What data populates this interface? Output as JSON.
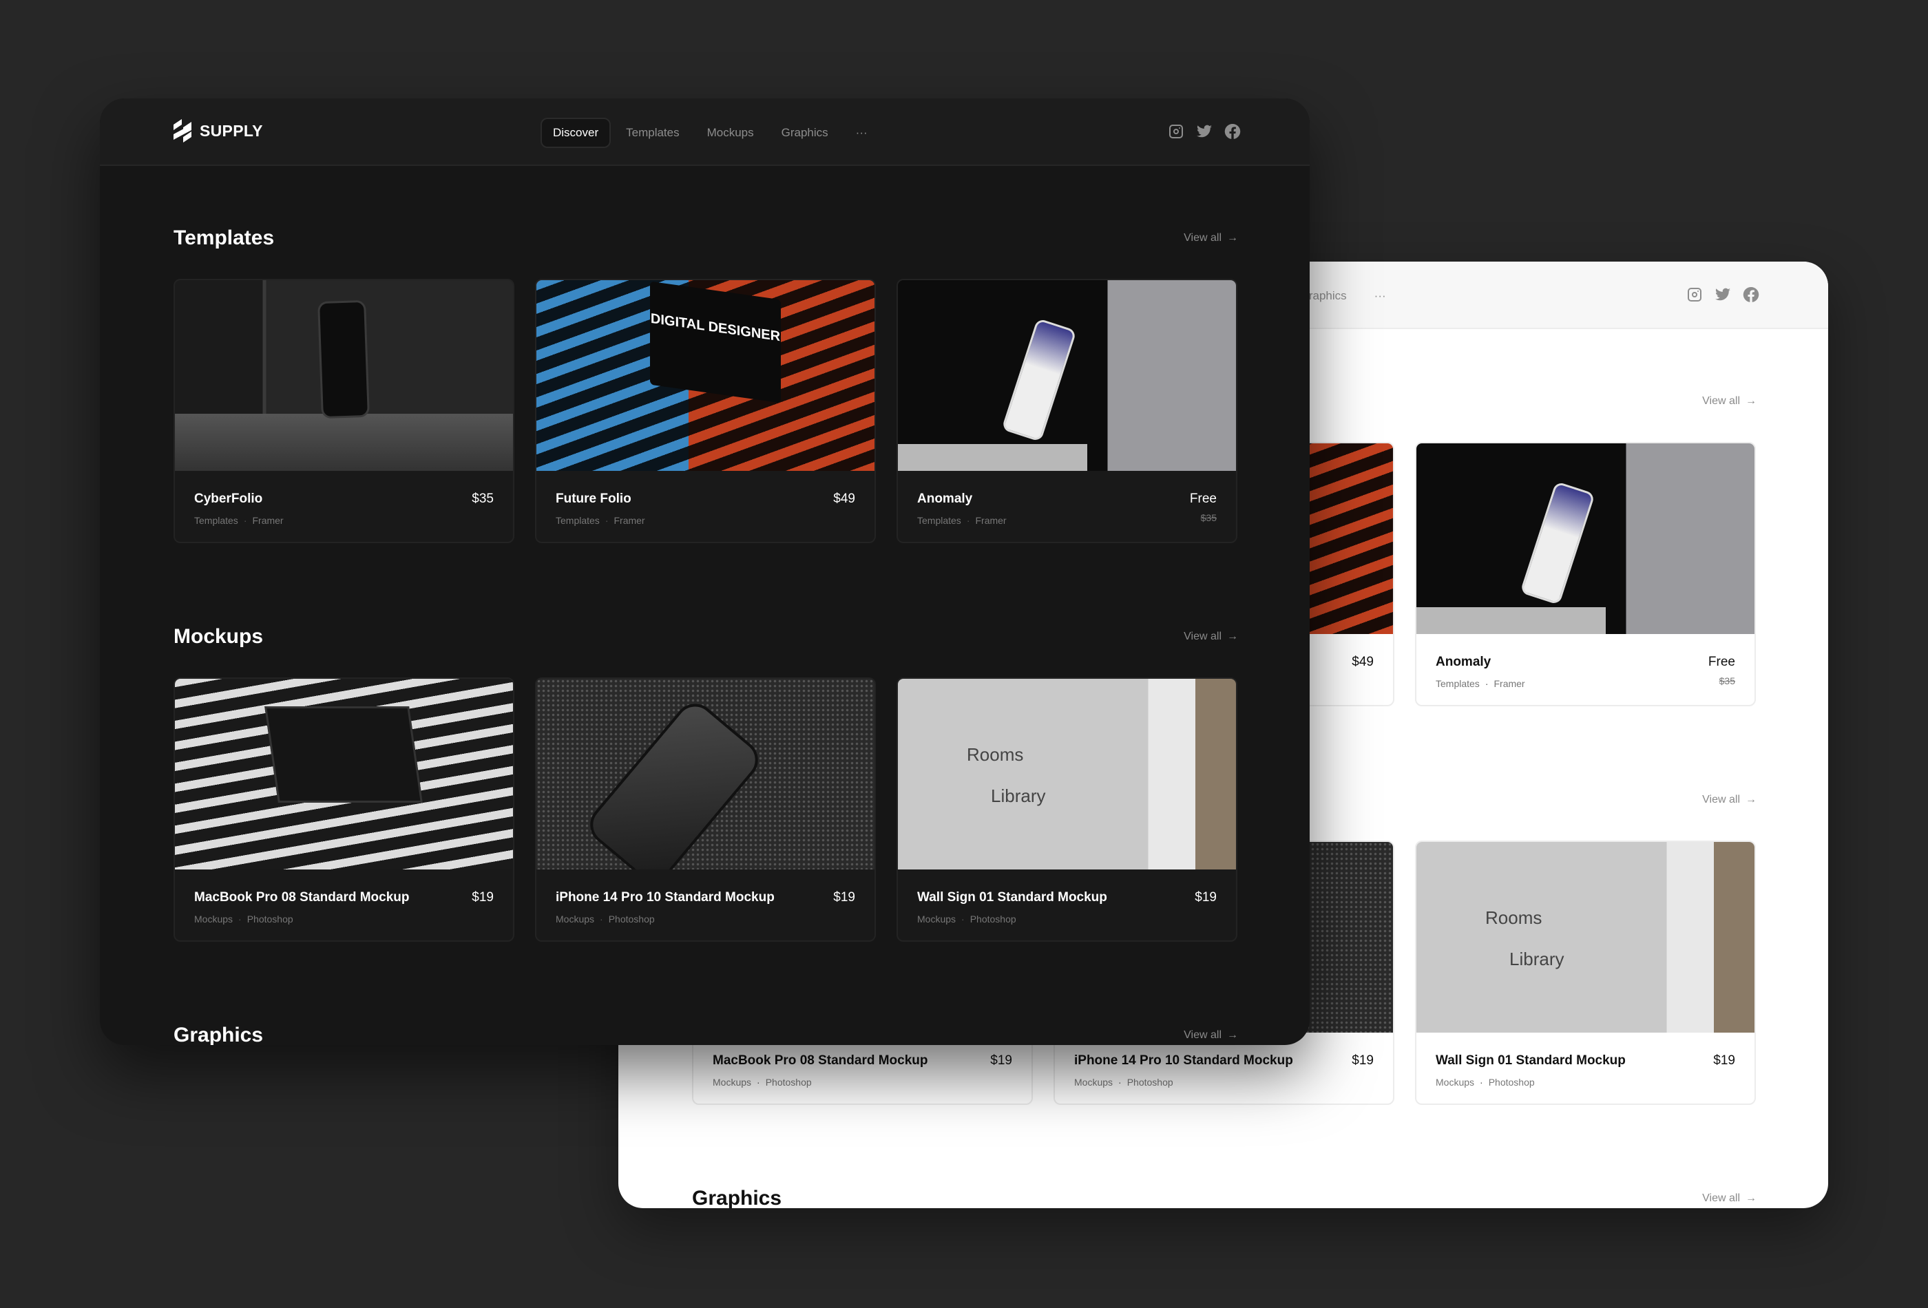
{
  "brand": {
    "name": "SUPPLY"
  },
  "nav": {
    "items": [
      "Discover",
      "Templates",
      "Mockups",
      "Graphics"
    ],
    "active": "Discover",
    "more": "···"
  },
  "social": [
    "instagram-icon",
    "twitter-icon",
    "facebook-icon"
  ],
  "sections": [
    {
      "title": "Templates",
      "view_all": "View all",
      "cards": [
        {
          "title": "CyberFolio",
          "price": "$35",
          "category": "Templates",
          "tool": "Framer"
        },
        {
          "title": "Future Folio",
          "price": "$49",
          "category": "Templates",
          "tool": "Framer",
          "image_text": "DIGITAL DESIGNER"
        },
        {
          "title": "Anomaly",
          "price": "Free",
          "old_price": "$35",
          "category": "Templates",
          "tool": "Framer"
        }
      ]
    },
    {
      "title": "Mockups",
      "view_all": "View all",
      "cards": [
        {
          "title": "MacBook Pro 08 Standard Mockup",
          "price": "$19",
          "category": "Mockups",
          "tool": "Photoshop"
        },
        {
          "title": "iPhone 14 Pro 10 Standard Mockup",
          "price": "$19",
          "category": "Mockups",
          "tool": "Photoshop"
        },
        {
          "title": "Wall Sign 01 Standard Mockup",
          "price": "$19",
          "category": "Mockups",
          "tool": "Photoshop",
          "image_text": [
            "Rooms",
            "Library"
          ]
        }
      ]
    },
    {
      "title": "Graphics",
      "view_all": "View all"
    }
  ],
  "colors": {
    "page_bg": "#272727",
    "dark_window": "#161616",
    "light_window": "#ffffff",
    "muted": "#8a8a8a"
  }
}
